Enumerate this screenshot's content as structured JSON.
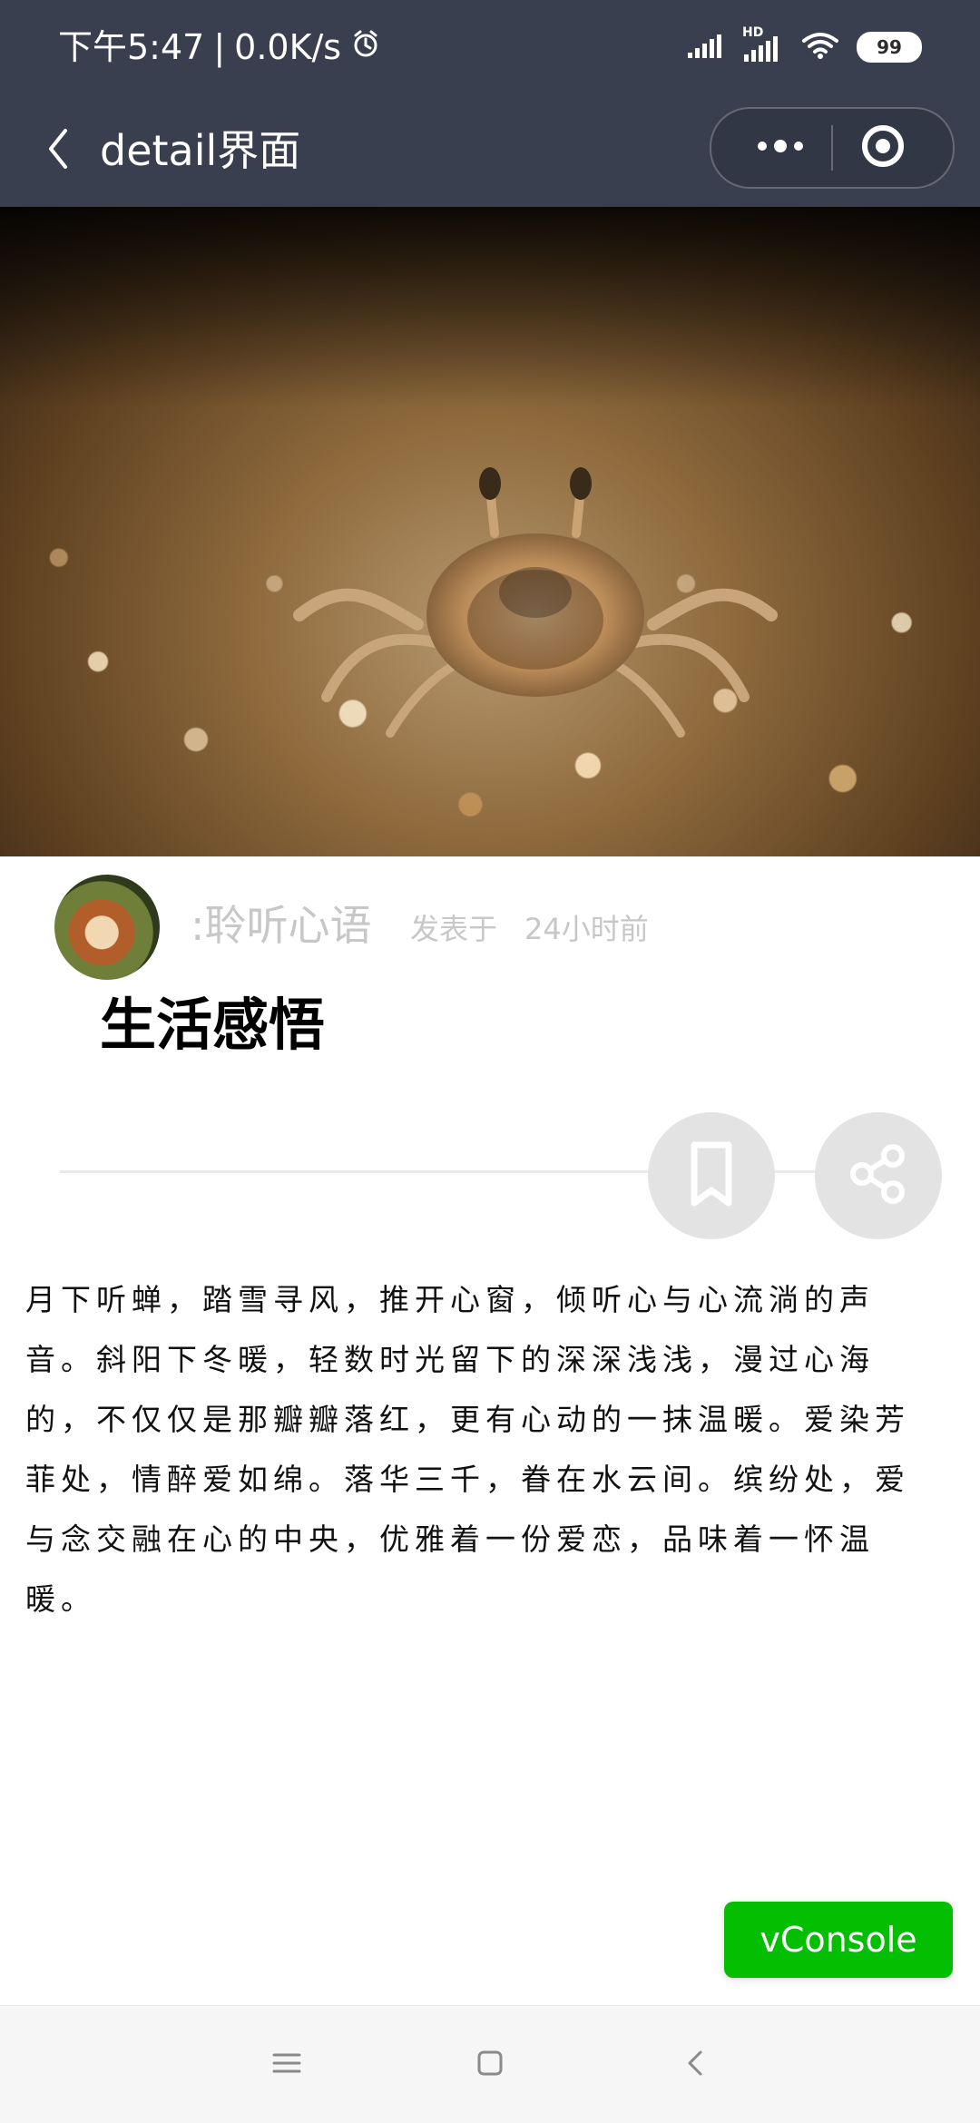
{
  "status_bar": {
    "time": "下午5:47",
    "separator": "|",
    "net_speed": "0.0K/s",
    "hd_label": "HD",
    "battery": "99"
  },
  "nav": {
    "title": "detail界面"
  },
  "colors": {
    "nav_bg": "#3a3f4f",
    "accent_green": "#04be02",
    "muted_text": "#c7c7c7"
  },
  "post": {
    "author": ":聆听心语",
    "posted_label": "发表于",
    "posted_time": "24小时前",
    "title": "生活感悟",
    "body": "月下听蝉，踏雪寻风，推开心窗，倾听心与心流淌的声音。斜阳下冬暖，轻数时光留下的深深浅浅，漫过心海的，不仅仅是那瓣瓣落红，更有心动的一抹温暖。爱染芳菲处，情醉爱如绵。落华三千，眷在水云间。缤纷处，爱与念交融在心的中央，优雅着一份爱恋，品味着一怀温暖。"
  },
  "actions": {
    "bookmark_icon": "bookmark-icon",
    "share_icon": "share-icon"
  },
  "vconsole": {
    "label": "vConsole"
  },
  "android_nav": {
    "menu_icon": "menu-icon",
    "home_icon": "home-icon",
    "back_icon": "back-icon"
  }
}
